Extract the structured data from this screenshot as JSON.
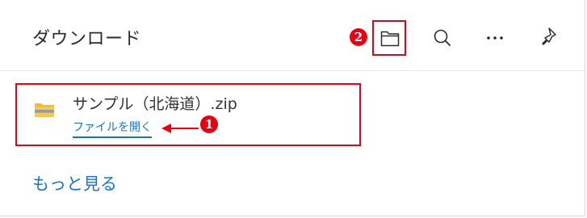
{
  "header": {
    "title": "ダウンロード"
  },
  "annotations": {
    "marker_1": "1",
    "marker_2": "2",
    "color": "#e60012"
  },
  "toolbar": {
    "icons": [
      "folder-icon",
      "search-icon",
      "more-icon",
      "pin-icon"
    ]
  },
  "download_item": {
    "filename": "サンプル（北海道）.zip",
    "open_link": "ファイルを開く",
    "icon": "zip-folder-icon"
  },
  "footer": {
    "see_more": "もっと見る"
  },
  "colors": {
    "link": "#1a73c9",
    "text": "#2b2b2b"
  }
}
